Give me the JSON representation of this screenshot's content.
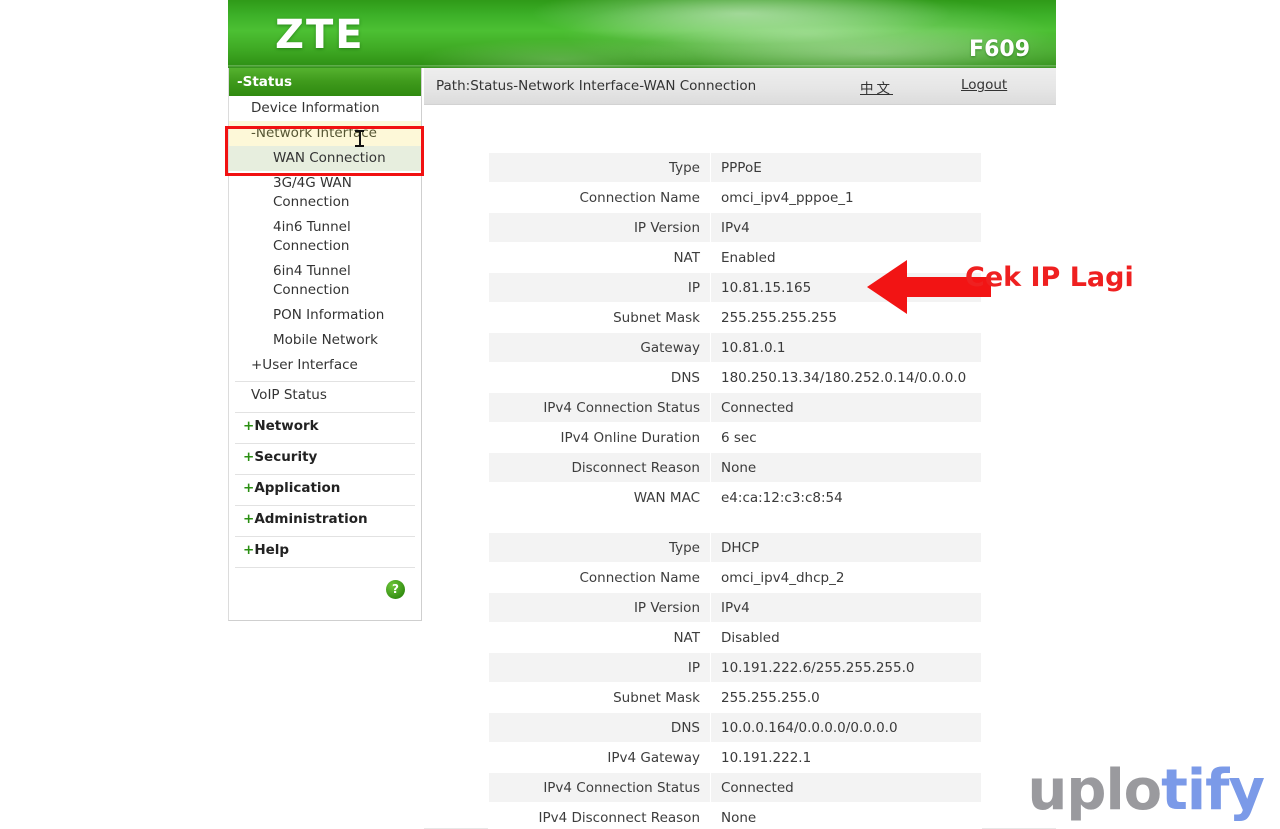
{
  "brand": {
    "logo": "ZTE",
    "model": "F609"
  },
  "pathbar": {
    "path": "Path:Status-Network Interface-WAN Connection",
    "language_link": "中文",
    "logout_link": "Logout"
  },
  "sidebar": {
    "status_header": "-Status",
    "items": [
      {
        "label": "Device Information",
        "level": 1,
        "state": "normal"
      },
      {
        "label": "-Network Interface",
        "level": 1,
        "state": "highlight-yellow"
      },
      {
        "label": "WAN Connection",
        "level": 2,
        "state": "highlight-green"
      },
      {
        "label": "3G/4G WAN Connection",
        "level": 2,
        "state": "normal"
      },
      {
        "label": "4in6 Tunnel Connection",
        "level": 2,
        "state": "normal"
      },
      {
        "label": "6in4 Tunnel Connection",
        "level": 2,
        "state": "normal"
      },
      {
        "label": "PON Information",
        "level": 2,
        "state": "normal"
      },
      {
        "label": "Mobile Network",
        "level": 2,
        "state": "normal"
      },
      {
        "label": "+User Interface",
        "level": 1,
        "state": "normal"
      }
    ],
    "voip_status": "VoIP Status",
    "groups": [
      {
        "plus": "+",
        "label": "Network"
      },
      {
        "plus": "+",
        "label": "Security"
      },
      {
        "plus": "+",
        "label": "Application"
      },
      {
        "plus": "+",
        "label": "Administration"
      },
      {
        "plus": "+",
        "label": "Help"
      }
    ],
    "help_badge": "?"
  },
  "tables": [
    {
      "id": "pppoe",
      "rows": [
        {
          "key": "Type",
          "value": "PPPoE"
        },
        {
          "key": "Connection Name",
          "value": "omci_ipv4_pppoe_1"
        },
        {
          "key": "IP Version",
          "value": "IPv4"
        },
        {
          "key": "NAT",
          "value": "Enabled"
        },
        {
          "key": "IP",
          "value": "10.81.15.165"
        },
        {
          "key": "Subnet Mask",
          "value": "255.255.255.255"
        },
        {
          "key": "Gateway",
          "value": "10.81.0.1"
        },
        {
          "key": "DNS",
          "value": "180.250.13.34/180.252.0.14/0.0.0.0"
        },
        {
          "key": "IPv4 Connection Status",
          "value": "Connected"
        },
        {
          "key": "IPv4 Online Duration",
          "value": "6 sec"
        },
        {
          "key": "Disconnect Reason",
          "value": "None"
        },
        {
          "key": "WAN MAC",
          "value": "e4:ca:12:c3:c8:54"
        }
      ]
    },
    {
      "id": "dhcp",
      "rows": [
        {
          "key": "Type",
          "value": "DHCP"
        },
        {
          "key": "Connection Name",
          "value": "omci_ipv4_dhcp_2"
        },
        {
          "key": "IP Version",
          "value": "IPv4"
        },
        {
          "key": "NAT",
          "value": "Disabled"
        },
        {
          "key": "IP",
          "value": "10.191.222.6/255.255.255.0"
        },
        {
          "key": "Subnet Mask",
          "value": "255.255.255.0"
        },
        {
          "key": "DNS",
          "value": "10.0.0.164/0.0.0.0/0.0.0.0"
        },
        {
          "key": "IPv4 Gateway",
          "value": "10.191.222.1"
        },
        {
          "key": "IPv4 Connection Status",
          "value": "Connected"
        },
        {
          "key": "IPv4 Disconnect Reason",
          "value": "None"
        }
      ]
    }
  ],
  "annotation": {
    "caption": "Cek IP Lagi",
    "color": "#ef2020",
    "arrow_direction": "left",
    "points_at": "IP"
  },
  "watermark": {
    "part_gray": "uplo",
    "part_blue": "tify",
    "color_gray": "#9a9a9e",
    "color_blue": "#7b9ae8"
  }
}
